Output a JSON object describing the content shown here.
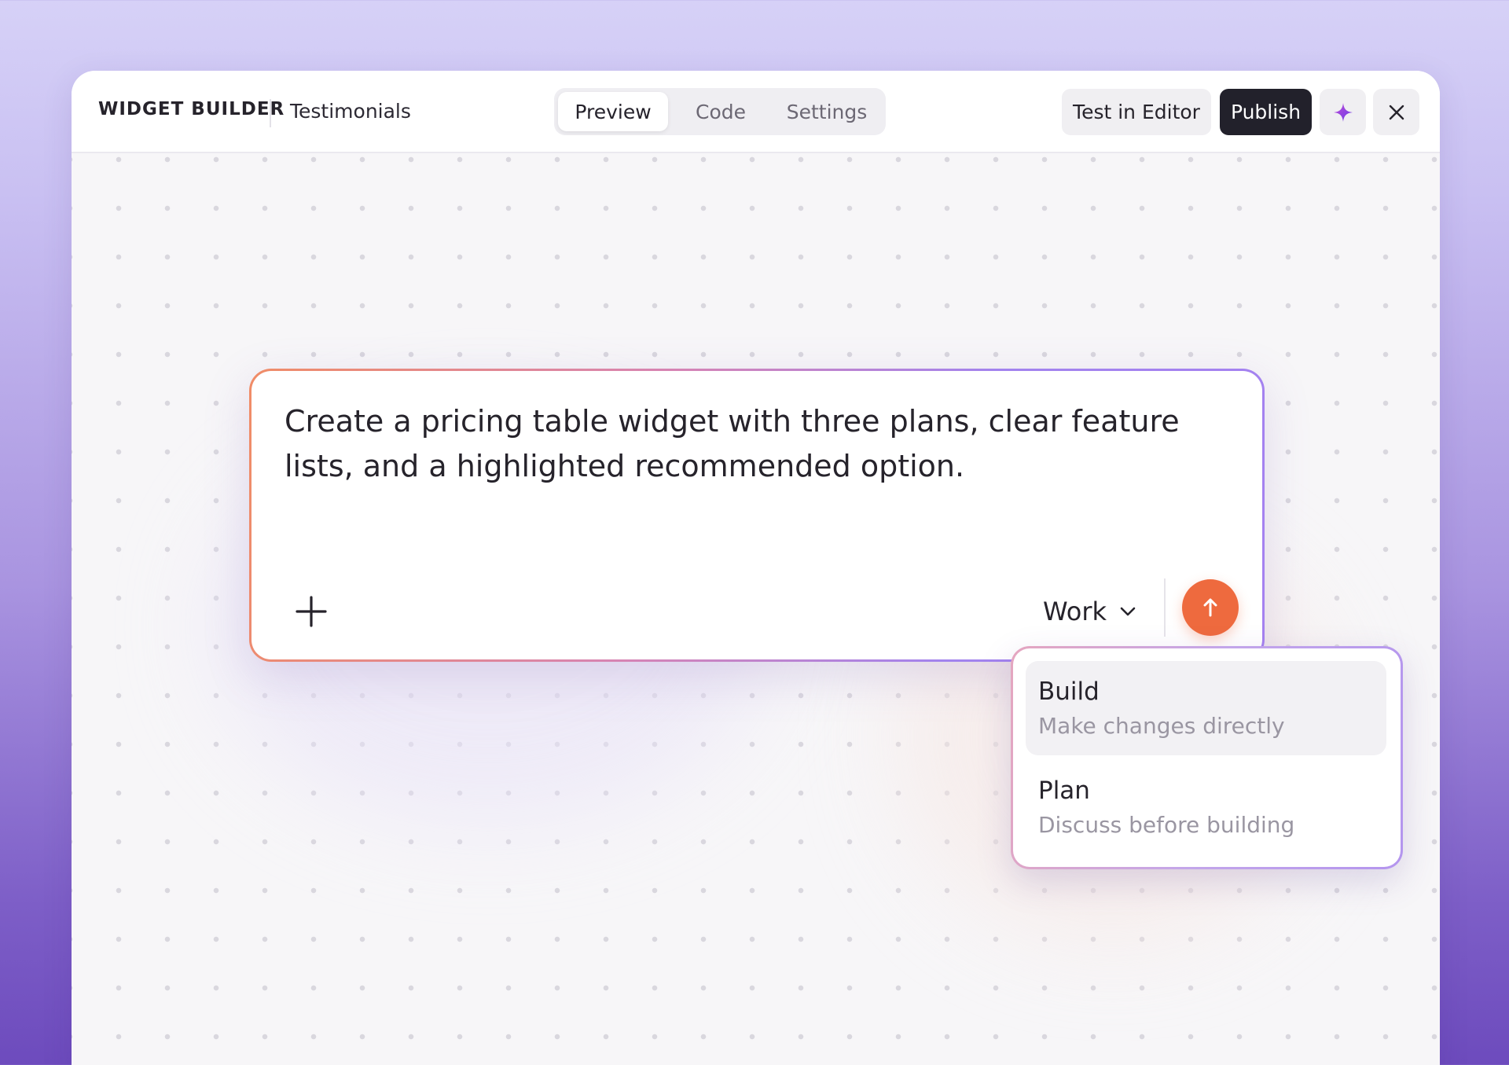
{
  "header": {
    "brand": "WIDGET BUILDER",
    "document_name": "Testimonials",
    "tabs": [
      {
        "label": "Preview",
        "active": true
      },
      {
        "label": "Code",
        "active": false
      },
      {
        "label": "Settings",
        "active": false
      }
    ],
    "test_button_label": "Test in Editor",
    "publish_button_label": "Publish",
    "ai_icon": "sparkle-icon",
    "close_icon": "close-icon"
  },
  "prompt": {
    "text": "Create a pricing table widget with three plans, clear feature lists, and a highlighted recommended option.",
    "attach_icon": "plus-icon",
    "mode_value": "Work",
    "mode_icon": "chevron-down-icon",
    "send_icon": "arrow-up-icon"
  },
  "mode_menu": {
    "options": [
      {
        "title": "Build",
        "description": "Make changes directly",
        "selected": true
      },
      {
        "title": "Plan",
        "description": "Discuss before building",
        "selected": false
      }
    ]
  },
  "colors": {
    "accent_orange": "#ee6a3e",
    "accent_purple": "#a283ee",
    "publish_bg": "#22212b",
    "sparkle": "#8a3fe0"
  }
}
